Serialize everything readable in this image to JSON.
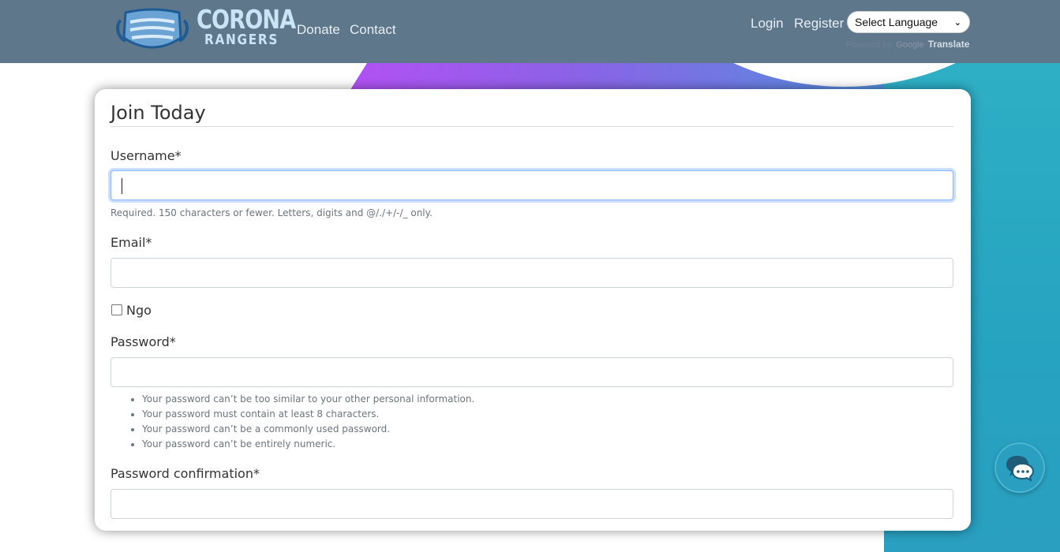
{
  "header": {
    "logo_line1": "CORONA",
    "logo_line2": "RANGERS",
    "nav_left": [
      "Donate",
      "Contact"
    ],
    "login": "Login",
    "register": "Register",
    "language_select": "Select Language",
    "powered_by": "Powered by",
    "google": "Google",
    "translate": "Translate"
  },
  "form": {
    "title": "Join Today",
    "username_label": "Username*",
    "username_value": "",
    "username_help": "Required. 150 characters or fewer. Letters, digits and @/./+/-/_ only.",
    "email_label": "Email*",
    "email_value": "",
    "ngo_label": "Ngo",
    "ngo_checked": false,
    "password_label": "Password*",
    "password_value": "",
    "password_help": [
      "Your password can’t be too similar to your other personal information.",
      "Your password must contain at least 8 characters.",
      "Your password can’t be a commonly used password.",
      "Your password can’t be entirely numeric."
    ],
    "password_confirm_label": "Password confirmation*",
    "password_confirm_value": ""
  },
  "colors": {
    "navbar": "#5f778b",
    "accent_teal": "#2a9fc0",
    "accent_purple": "#b550f5"
  },
  "icons": {
    "logo": "face-mask-icon",
    "chat": "chat-bubbles-icon",
    "select_chevron": "chevron-down-icon"
  }
}
